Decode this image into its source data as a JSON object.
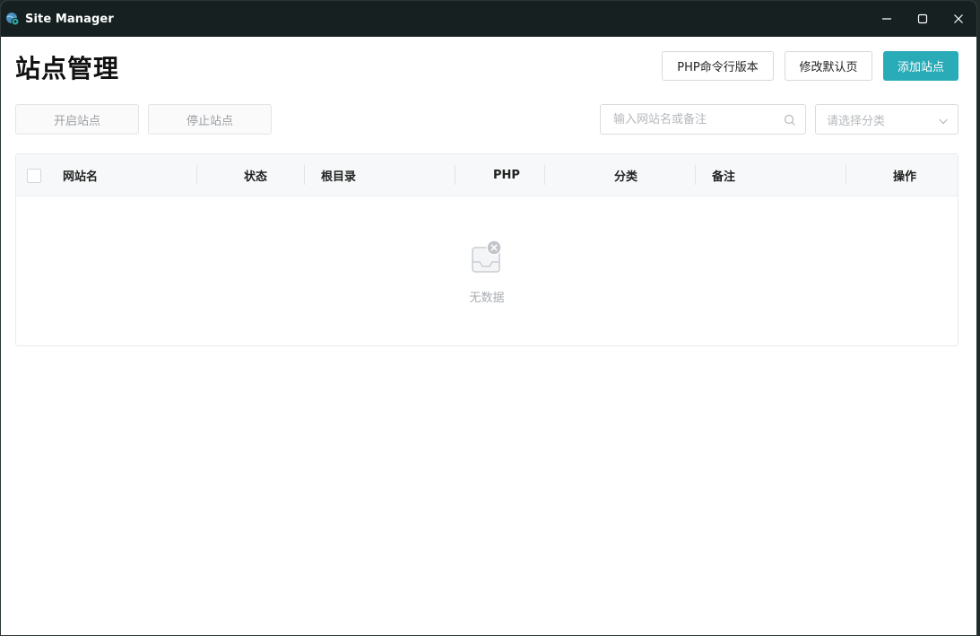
{
  "window": {
    "title": "Site Manager",
    "icon": "globe-gear-icon"
  },
  "header": {
    "page_title": "站点管理",
    "php_cli_label": "PHP命令行版本",
    "edit_default_label": "修改默认页",
    "add_site_label": "添加站点"
  },
  "toolbar": {
    "start_label": "开启站点",
    "stop_label": "停止站点",
    "search_placeholder": "输入网站名或备注",
    "category_placeholder": "请选择分类"
  },
  "table": {
    "columns": [
      "网站名",
      "状态",
      "根目录",
      "PHP",
      "分类",
      "备注",
      "操作"
    ],
    "rows": [],
    "empty_text": "无数据"
  },
  "colors": {
    "accent": "#2aabb8",
    "titlebar": "#162020"
  }
}
